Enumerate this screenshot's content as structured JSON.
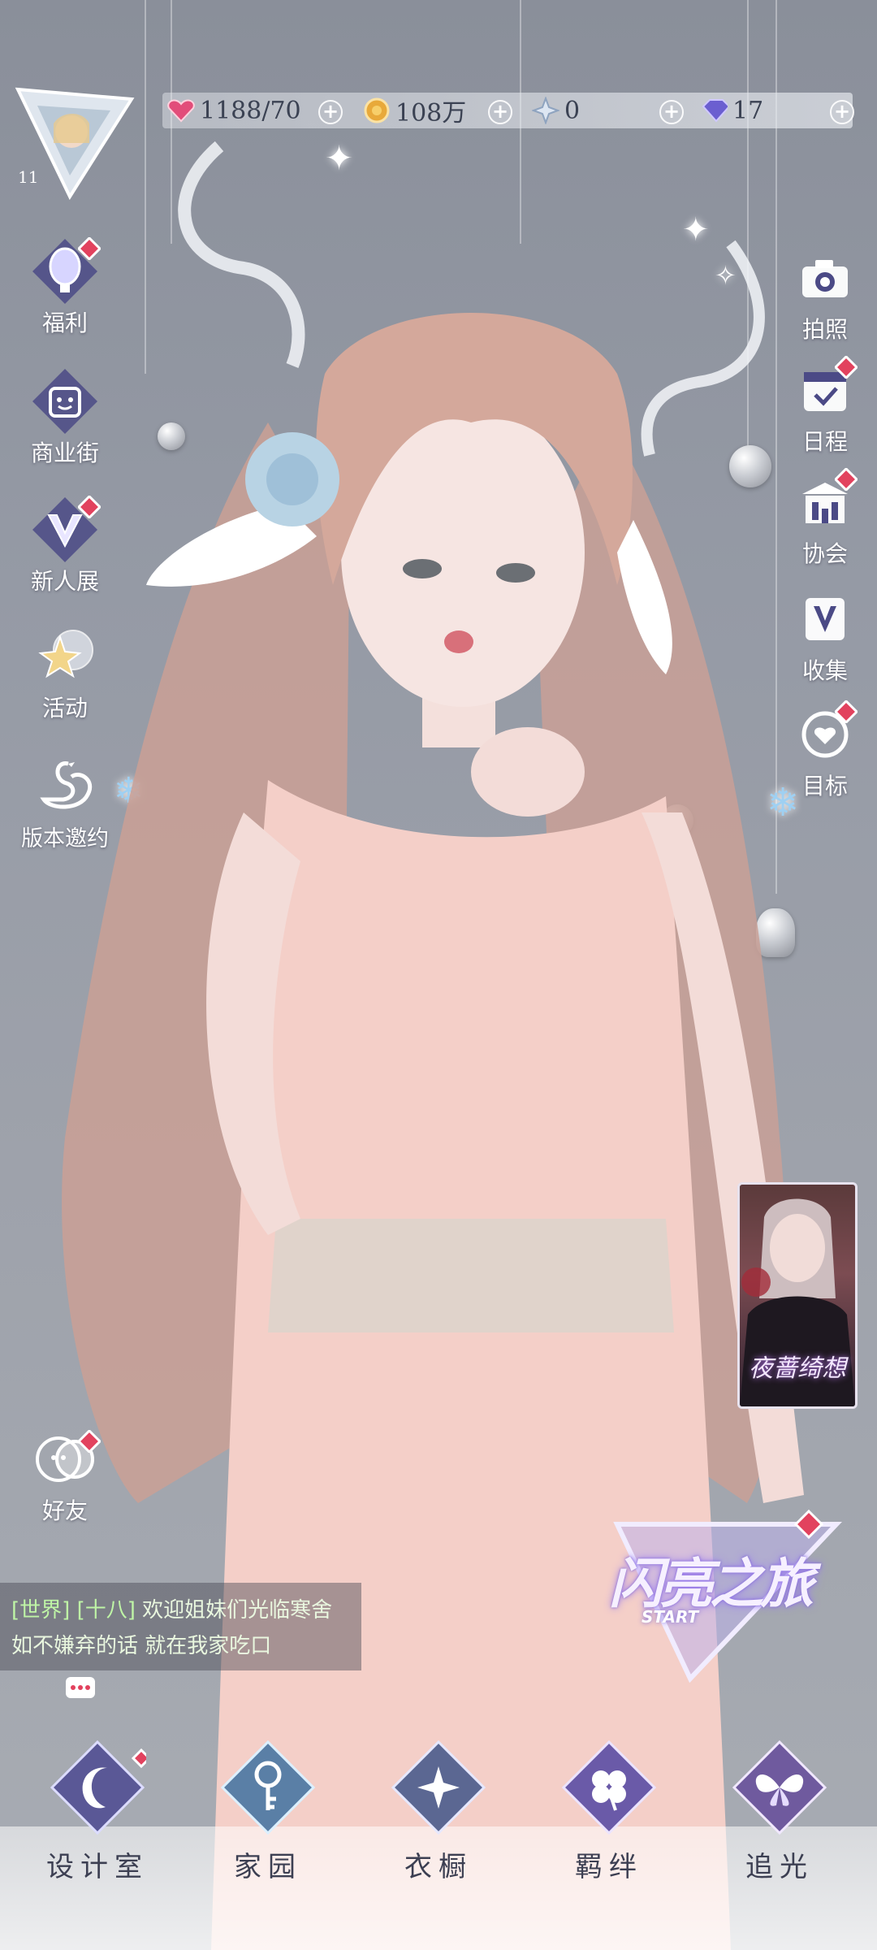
{
  "resources": [
    {
      "name": "stamina",
      "icon": "heart-gem-icon",
      "value": "1188/70",
      "color": "#e24d7a"
    },
    {
      "name": "gold",
      "icon": "gold-coin-icon",
      "value": "108万",
      "color": "#e8a93a"
    },
    {
      "name": "crystal",
      "icon": "snowflake-crystal-icon",
      "value": "0",
      "color": "#b6c2d8"
    },
    {
      "name": "diamond",
      "icon": "diamond-icon",
      "value": "17",
      "color": "#6b5fd0"
    }
  ],
  "player": {
    "level": "11"
  },
  "left_menu": [
    {
      "label": "福利",
      "icon": "balloon-icon",
      "badge": true
    },
    {
      "label": "商业街",
      "icon": "shopping-bag-icon",
      "badge": false
    },
    {
      "label": "新人展",
      "icon": "v-crown-icon",
      "badge": true
    },
    {
      "label": "活动",
      "icon": "star-bubble-icon",
      "badge": false
    },
    {
      "label": "版本邀约",
      "icon": "swan-icon",
      "badge": false
    }
  ],
  "right_menu": [
    {
      "label": "拍照",
      "icon": "camera-icon",
      "badge": false
    },
    {
      "label": "日程",
      "icon": "calendar-check-icon",
      "badge": true
    },
    {
      "label": "协会",
      "icon": "building-icon",
      "badge": true
    },
    {
      "label": "收集",
      "icon": "v-book-icon",
      "badge": false
    },
    {
      "label": "目标",
      "icon": "heart-target-icon",
      "badge": true
    }
  ],
  "friends": {
    "label": "好友",
    "badge": true
  },
  "chat": {
    "channel": "[世界]",
    "sender": "[十八]",
    "message": "欢迎姐妹们光临寒舍 如不嫌弃的话 就在我家吃口"
  },
  "promo_card": {
    "title": "夜蔷绮想"
  },
  "journey": {
    "title": "闪亮之旅",
    "subtitle": "START"
  },
  "bottom_nav": [
    {
      "label": "设计室",
      "icon": "moon-gem-icon",
      "badge": true
    },
    {
      "label": "家园",
      "icon": "key-gem-icon",
      "badge": false
    },
    {
      "label": "衣橱",
      "icon": "snow-gem-icon",
      "badge": false
    },
    {
      "label": "羁绊",
      "icon": "clover-gem-icon",
      "badge": false
    },
    {
      "label": "追光",
      "icon": "butterfly-gem-icon",
      "badge": false
    }
  ]
}
